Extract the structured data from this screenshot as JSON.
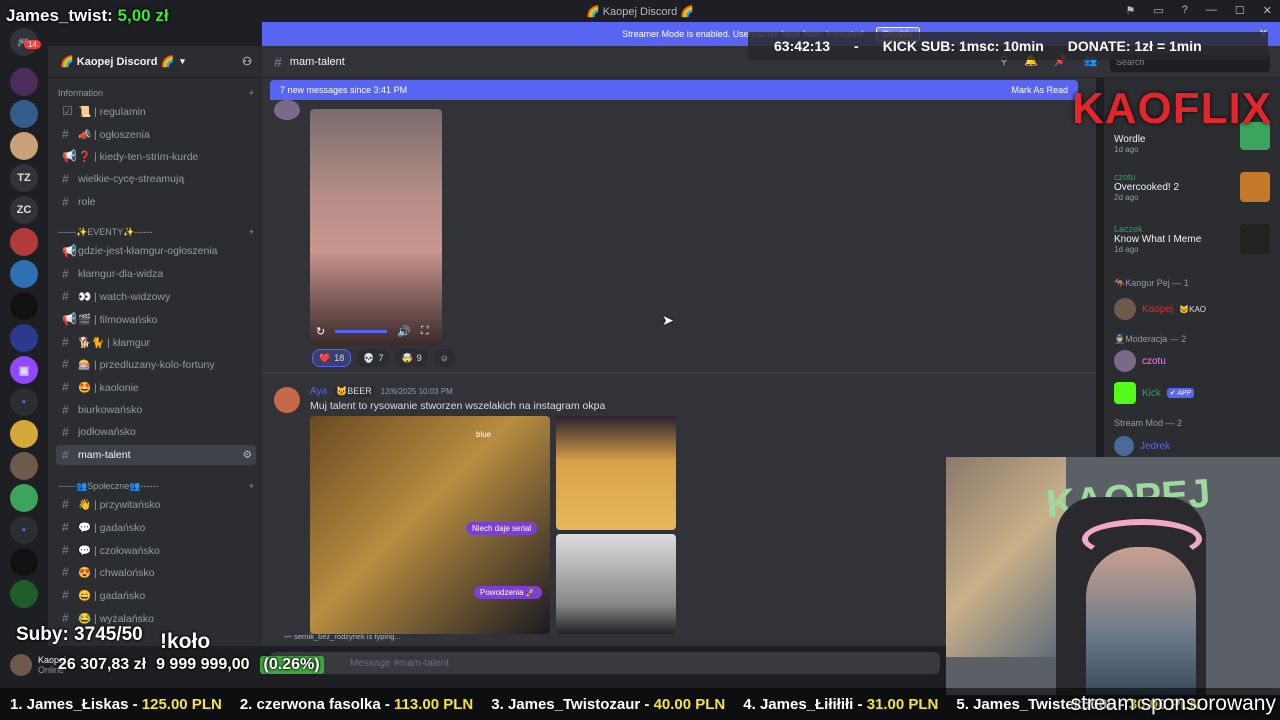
{
  "window": {
    "title": "🌈 Kaopej Discord 🌈",
    "min": "—",
    "max": "☐",
    "close": "✕"
  },
  "overlay": {
    "user": "James_twist:",
    "user_amount": "5,00 zł",
    "subs": "Suby: 3745/50",
    "kolo": "!koło",
    "bottom_amount": "26 307,83 zł",
    "goal": "9 999 999,00",
    "percent": "(0.26%)",
    "timer": "63:42:13",
    "dash": "-",
    "kick_sub": "KICK SUB: 1msc: 10min",
    "donate": "DONATE: 1zł = 1min",
    "kaoflix": "KAOFLIX",
    "sponsor": "stream sponsorowany",
    "webcam_sign": "KAOPEJ"
  },
  "ticker": [
    {
      "label": "1. James_Łiskas -",
      "amount": "125.00 PLN"
    },
    {
      "label": "2. czerwona fasolka -",
      "amount": "113.00 PLN"
    },
    {
      "label": "3. James_Twistozaur -",
      "amount": "40.00 PLN"
    },
    {
      "label": "4. James_Łiłiłiłi -",
      "amount": "31.00 PLN"
    },
    {
      "label": "5. James_Twistek5000 -",
      "amount": "30.00 PLN"
    }
  ],
  "servers": {
    "badge": "14",
    "tz": "TZ",
    "zc": "ZC"
  },
  "guild": {
    "name": "🌈 Kaopej Discord 🌈"
  },
  "sidebar": {
    "cat_info": "Information",
    "cat_eventy": "------✨EVENTY✨------",
    "cat_spol": "------👥Społeczne👥------",
    "items": [
      {
        "label": "📜 | regulamin",
        "icon": "☑"
      },
      {
        "label": "📣 | ogłoszenia",
        "icon": "#"
      },
      {
        "label": "❓ | kiedy-ten-strim-kurde",
        "icon": "📢"
      },
      {
        "label": "wielkie-cycę-streamują",
        "icon": "#"
      },
      {
        "label": "role",
        "icon": "#"
      },
      {
        "label": "gdzie-jest-kłamgur-ogłoszenia",
        "icon": "📢"
      },
      {
        "label": "kłamgur-dla-widza",
        "icon": "#"
      },
      {
        "label": "👀 | watch-widzowy",
        "icon": "#"
      },
      {
        "label": "🎬 | filmowańsko",
        "icon": "📢"
      },
      {
        "label": "🐕🐈 | kłamgur",
        "icon": "#"
      },
      {
        "label": "🎰 | przedluzany-kolo-fortuny",
        "icon": "#"
      },
      {
        "label": "🤩 | kaolonie",
        "icon": "#"
      },
      {
        "label": "biurkowańsko",
        "icon": "#"
      },
      {
        "label": "jodłowańsko",
        "icon": "#"
      },
      {
        "label": "mam-talent",
        "icon": "#"
      },
      {
        "label": "👋 | przywitańsko",
        "icon": "#"
      },
      {
        "label": "💬 | gadańsko",
        "icon": "#"
      },
      {
        "label": "💬 | czołowańsko",
        "icon": "#"
      },
      {
        "label": "😍 | chwalońsko",
        "icon": "#"
      },
      {
        "label": "😄 | gadańsko",
        "icon": "#"
      },
      {
        "label": "😂 | wyżalańsko",
        "icon": "#"
      }
    ],
    "user": "Kaopej",
    "user_status": "Online"
  },
  "streamer": {
    "text": "Streamer Mode is enabled. Usernames have been truncated.",
    "disable": "Disable"
  },
  "header": {
    "channel": "mam-talent",
    "search": "Search"
  },
  "newbar": {
    "text": "7 new messages since 3:41 PM",
    "mark": "Mark As Read"
  },
  "messages": {
    "reactions": [
      {
        "emoji": "❤️",
        "count": "18"
      },
      {
        "emoji": "💀",
        "count": "7"
      },
      {
        "emoji": "🤯",
        "count": "9"
      }
    ],
    "msg2_author": "Aya",
    "msg2_tag": "🐱BEER",
    "msg2_time": "12/6/2025 10:03 PM",
    "msg2_text": "Muj talent to rysowanie stworzen wszelakich na instagram okpa",
    "img_bubble1": "Niech daje serial",
    "img_bubble2": "Powodzenia 🚀",
    "img_label": "blue"
  },
  "typing": "sernik_bez_rodzynek is typing...",
  "composer": {
    "placeholder": "Message #mam-talent"
  },
  "members": {
    "activity": [
      {
        "user": "",
        "title": "Wordle",
        "time": "1d ago"
      },
      {
        "user": "czotu",
        "title": "Overcooked! 2",
        "time": "2d ago"
      },
      {
        "user": "Laczek",
        "title": "Know What I Meme",
        "time": "1d ago"
      }
    ],
    "grp1": "🦘Kangur Pej — 1",
    "m1": "Kaopej",
    "m1_tag": "🐱KAO",
    "grp2": "👮Moderacja — 2",
    "m2": "czotu",
    "m3": "Kick",
    "m3_tag": "✔ APP",
    "grp3": "Stream Mod — 2",
    "m4": "Jedrek"
  },
  "colors": {
    "accent": "#5865f2",
    "green": "#23a55a",
    "yellow": "#f5e24b",
    "red": "#e4252b"
  }
}
